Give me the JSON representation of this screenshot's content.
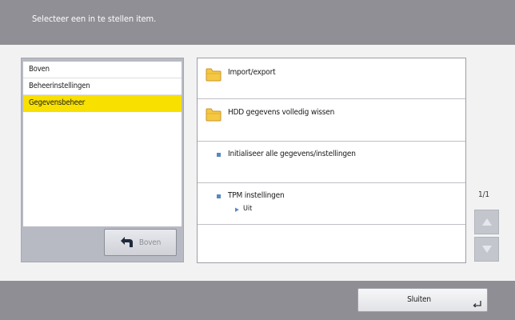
{
  "header": {
    "instruction": "Selecteer een in te stellen item."
  },
  "left_panel": {
    "items": [
      {
        "label": "Boven",
        "selected": false
      },
      {
        "label": "Beheerinstellingen",
        "selected": false
      },
      {
        "label": "Gegevensbeheer",
        "selected": true
      }
    ],
    "up_button_label": "Boven",
    "up_button_icon": "return-arrow-icon"
  },
  "right_panel": {
    "items": [
      {
        "label": "Import/export",
        "icon": "folder-icon"
      },
      {
        "label": "HDD gegevens volledig wissen",
        "icon": "folder-icon"
      },
      {
        "label": "Initialiseer alle gegevens/instellingen",
        "icon": "bullet-icon"
      },
      {
        "label": "TPM instellingen",
        "icon": "bullet-icon",
        "value": "Uit"
      }
    ]
  },
  "pager": {
    "indicator": "1/1",
    "up_icon": "triangle-up-icon",
    "down_icon": "triangle-down-icon"
  },
  "footer": {
    "close_label": "Sluiten",
    "close_icon": "enter-corner-icon"
  },
  "colors": {
    "header_bg": "#8f8f95",
    "selection": "#f8e000",
    "bullet": "#5a86c2",
    "folder": "#f5c842"
  }
}
